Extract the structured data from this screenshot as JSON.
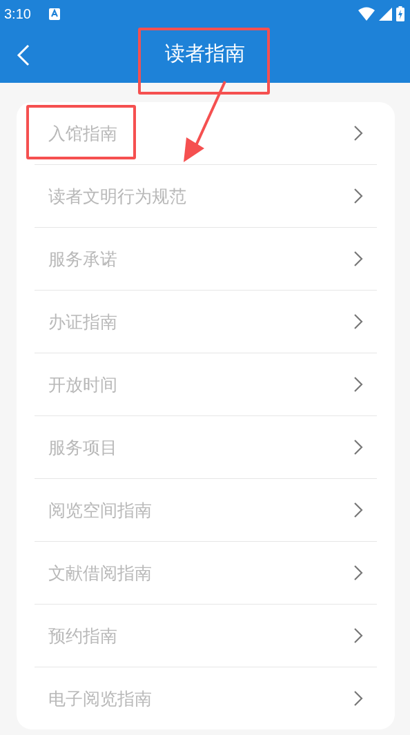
{
  "status_bar": {
    "time": "3:10"
  },
  "header": {
    "title": "读者指南"
  },
  "items": [
    {
      "label": "入馆指南"
    },
    {
      "label": "读者文明行为规范"
    },
    {
      "label": "服务承诺"
    },
    {
      "label": "办证指南"
    },
    {
      "label": "开放时间"
    },
    {
      "label": "服务项目"
    },
    {
      "label": "阅览空间指南"
    },
    {
      "label": "文献借阅指南"
    },
    {
      "label": "预约指南"
    },
    {
      "label": "电子阅览指南"
    }
  ]
}
